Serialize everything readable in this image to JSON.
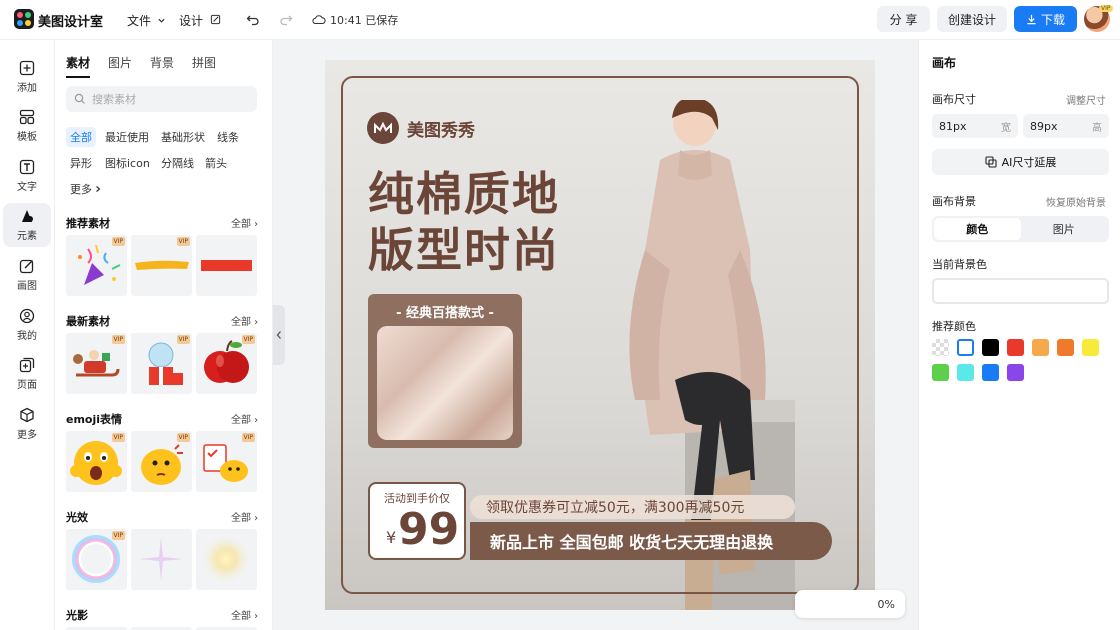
{
  "app": {
    "name": "美图设计室",
    "menu_file": "文件",
    "menu_design": "设计",
    "save_status": "10:41 已保存",
    "share_label": "分 享",
    "create_label": "创建设计",
    "download_label": "下载",
    "avatar_badge": "VIP"
  },
  "sidebar": {
    "items": [
      {
        "label": "添加",
        "icon": "plus-square-icon"
      },
      {
        "label": "模板",
        "icon": "template-icon"
      },
      {
        "label": "文字",
        "icon": "text-icon"
      },
      {
        "label": "元素",
        "icon": "elements-icon"
      },
      {
        "label": "画图",
        "icon": "draw-icon"
      },
      {
        "label": "我的",
        "icon": "user-icon"
      },
      {
        "label": "页面",
        "icon": "page-icon"
      },
      {
        "label": "更多",
        "icon": "cube-icon"
      }
    ]
  },
  "panel": {
    "tabs": [
      "素材",
      "图片",
      "背景",
      "拼图"
    ],
    "search_placeholder": "搜索素材",
    "chips": [
      "全部",
      "最近使用",
      "基础形状",
      "线条",
      "异形",
      "图标icon",
      "分隔线",
      "箭头",
      "更多"
    ],
    "all_label": "全部",
    "vip_label": "VIP",
    "sections": [
      "推荐素材",
      "最新素材",
      "emoji表情",
      "光效",
      "光影"
    ]
  },
  "canvas": {
    "brand_name": "美图秀秀",
    "headline_1": "纯棉质地",
    "headline_2": "版型时尚",
    "feature_label": "- 经典百搭款式 -",
    "price_caption": "活动到手价仅",
    "price_symbol": "¥",
    "price_value": "99",
    "promo_1": "领取优惠券可立减50元，满300再减50元",
    "promo_2": "新品上市 全国包邮 收货七天无理由退换",
    "zoom_fragment": "0%"
  },
  "right_panel": {
    "title": "画布",
    "size_label": "画布尺寸",
    "adjust_size": "调整尺寸",
    "width_value": "81px",
    "width_unit": "宽",
    "height_value": "89px",
    "height_unit": "高",
    "ai_button": "AI尺寸延展",
    "bg_label": "画布背景",
    "restore_bg": "恢复原始背景",
    "seg_color": "颜色",
    "seg_image": "图片",
    "current_bg_label": "当前背景色",
    "recommended_label": "推荐颜色",
    "swatches": [
      "transparent",
      "#ffffff",
      "#000000",
      "#e8392b",
      "#f5a94a",
      "#ee7a2a",
      "#f8ea3a",
      "#5dcf4a",
      "#5ae8e8",
      "#1a7cf5",
      "#8a46e8"
    ]
  },
  "colors": {
    "accent": "#1a7cf5",
    "poster_brown": "#6b4538"
  }
}
